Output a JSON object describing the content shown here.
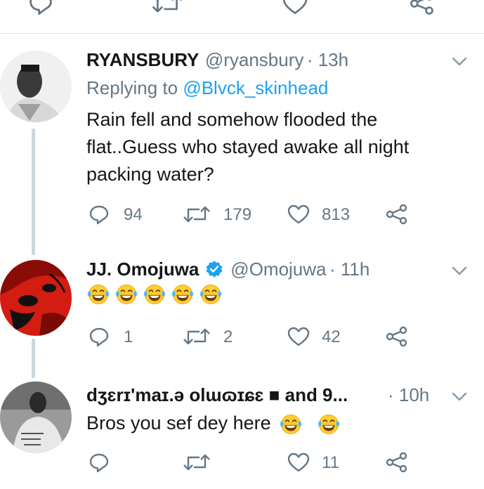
{
  "top_actions": [
    {
      "icon": "reply-icon"
    },
    {
      "icon": "retweet-icon"
    },
    {
      "icon": "like-icon"
    },
    {
      "icon": "share-icon"
    }
  ],
  "tweets": [
    {
      "name": "RYANSBURY",
      "handle": "@ryansbury",
      "time": "· 13h",
      "replying_prefix": "Replying to",
      "replying_to": "@Blvck_skinhead",
      "text_lines": [
        "Rain fell and somehow flooded the",
        "flat..Guess who stayed awake all night",
        "packing water?"
      ],
      "counts": {
        "replies": "94",
        "retweets": "179",
        "likes": "813"
      }
    },
    {
      "name": "JJ. Omojuwa",
      "verified": true,
      "handle": "@Omojuwa",
      "time": "· 11h",
      "emoji_count": 5,
      "emoji": "face-with-tears-of-joy",
      "counts": {
        "replies": "1",
        "retweets": "2",
        "likes": "42"
      }
    },
    {
      "name": "dʒɛrɪ'maɪ.ə olɯɷɪɕɛ ■ and 9...",
      "handle": "",
      "time": "· 10h",
      "text": "Bros you sef dey here",
      "emoji_count": 2,
      "emoji": "face-with-tears-of-joy",
      "counts": {
        "replies": "",
        "retweets": "",
        "likes": "11"
      }
    }
  ],
  "colors": {
    "link": "#1da1f2",
    "secondary_text": "#657786",
    "verified_badge": "#1da1f2",
    "thread_line": "#ccd6dd",
    "divider": "#e1e8ed"
  }
}
